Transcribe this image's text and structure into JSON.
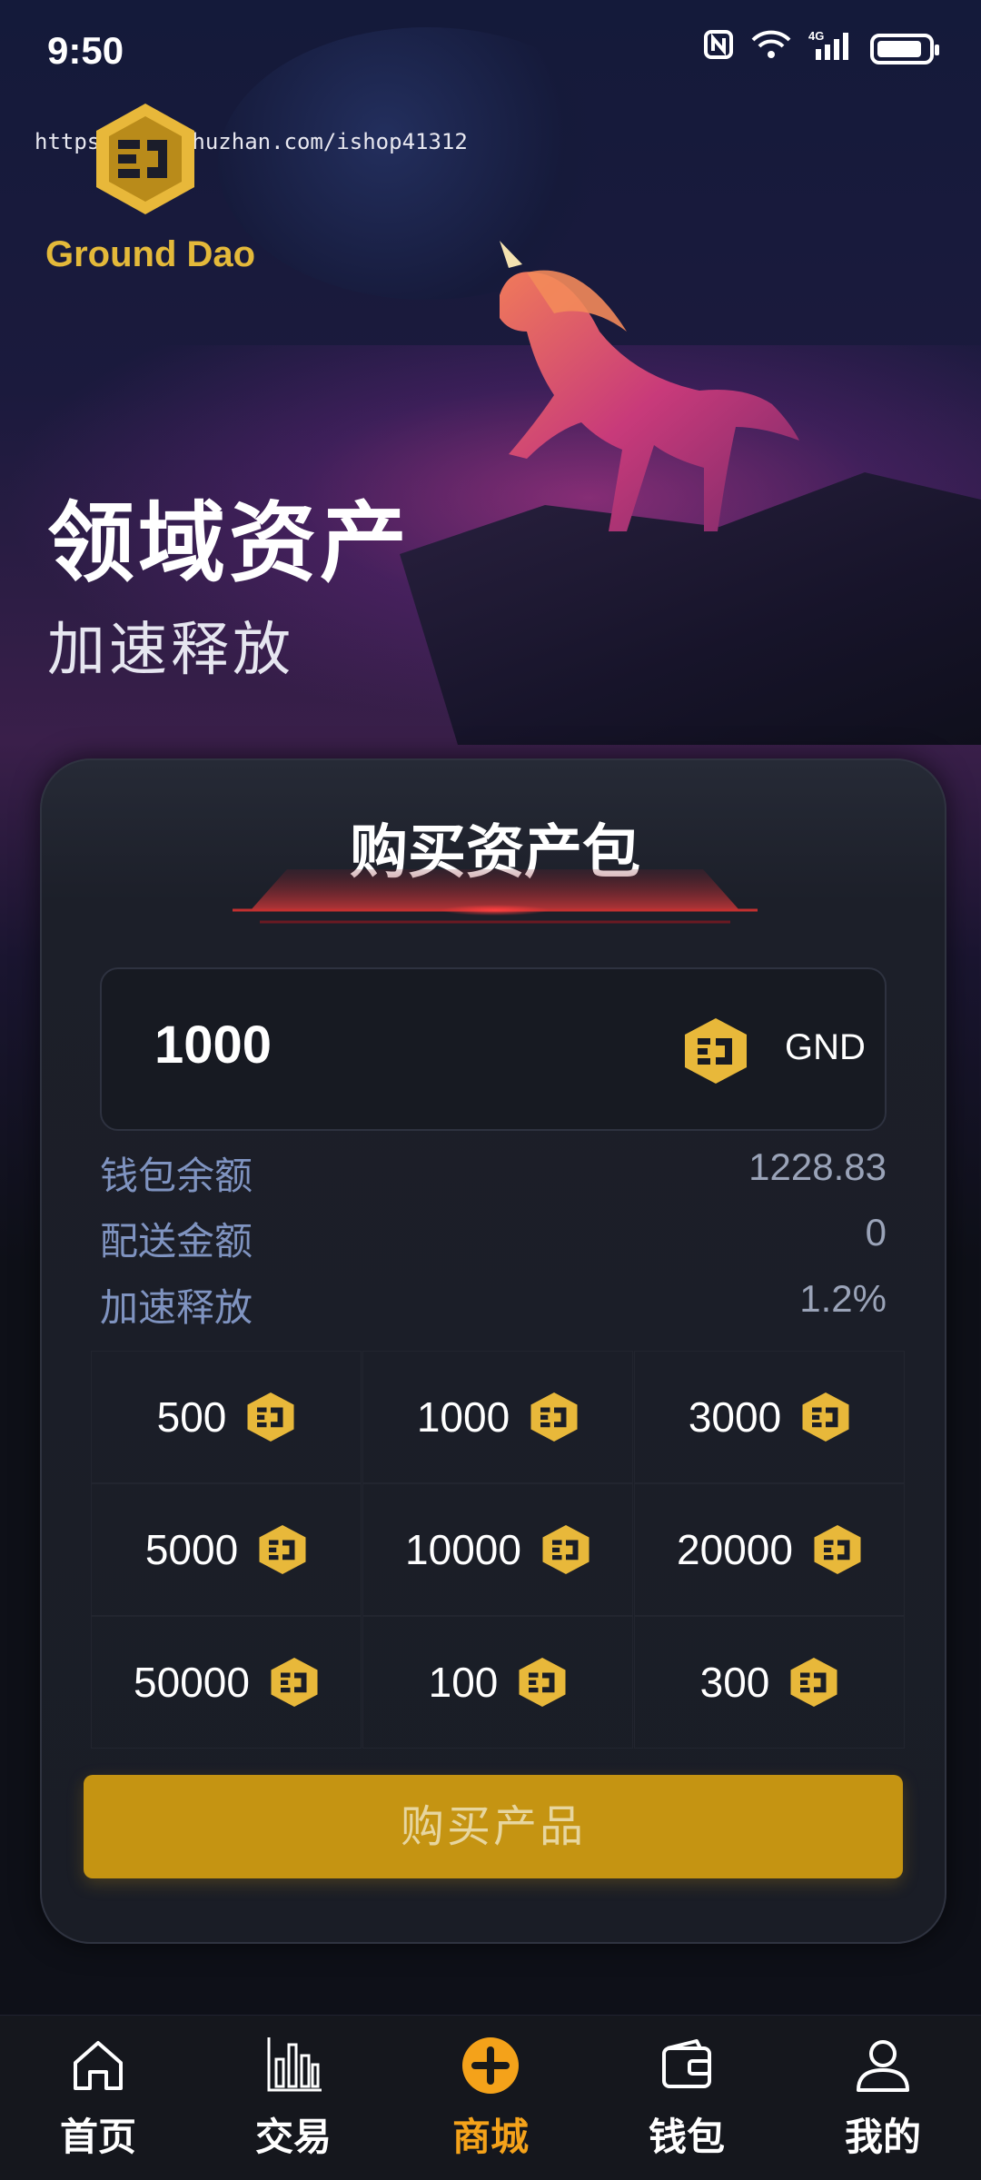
{
  "status_bar": {
    "time": "9:50",
    "network": "4G"
  },
  "header": {
    "watermark": "https://www.huzhan.com/ishop41312",
    "brand_name": "Ground Dao",
    "title": "领域资产",
    "subtitle": "加速释放"
  },
  "purchase_card": {
    "title": "购买资产包",
    "amount_value": "1000",
    "amount_unit": "GND",
    "info_rows": [
      {
        "label": "钱包余额",
        "value": "1228.83"
      },
      {
        "label": "配送金额",
        "value": "0"
      },
      {
        "label": "加速释放",
        "value": "1.2%"
      }
    ],
    "packages": [
      "500",
      "1000",
      "3000",
      "5000",
      "10000",
      "20000",
      "50000",
      "100",
      "300"
    ],
    "buy_label": "购买产品"
  },
  "bottom_nav": {
    "items": [
      {
        "label": "首页",
        "icon": "home-icon",
        "active": false
      },
      {
        "label": "交易",
        "icon": "chart-icon",
        "active": false
      },
      {
        "label": "商城",
        "icon": "plus-circle-icon",
        "active": true
      },
      {
        "label": "钱包",
        "icon": "wallet-icon",
        "active": false
      },
      {
        "label": "我的",
        "icon": "user-icon",
        "active": false
      }
    ]
  },
  "colors": {
    "accent": "#f4a21a",
    "button": "#c59412",
    "brand_gold": "#e4b93a",
    "label_blue": "#7f93c0"
  }
}
